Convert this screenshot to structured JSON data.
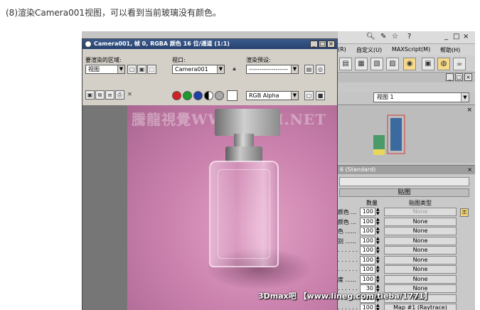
{
  "caption": "(8)渲染Camera001视图，可以看到当前玻璃没有颜色。",
  "render_window": {
    "title": "Camera001, 帧 0, RGBA 颜色 16 位/通道 (1:1)",
    "area_label": "要渲染的区域:",
    "area_value": "视图",
    "viewport_label": "视口:",
    "viewport_value": "Camera001",
    "preset_label": "渲染预设:",
    "preset_value": "-------------------",
    "channel_value": "RGB Alpha",
    "watermark": "騰龍視覺WWW.TLVI.NET"
  },
  "max_window": {
    "title_icons": [
      "binoculars-icon",
      "search-icon",
      "star-icon",
      "help-icon"
    ],
    "menu": [
      "(R)",
      "自定义(U)",
      "MAXScript(M)",
      "帮助(H)"
    ],
    "viewport_select": "视图 1",
    "mat_header": "6 (Standard)",
    "maps_title": "贴图",
    "col_amount": "数量",
    "col_maptype": "贴图类型",
    "rows": [
      {
        "label": "颜色 ...",
        "amount": "100",
        "map": "None",
        "disabled": true
      },
      {
        "label": "颜色 ...",
        "amount": "100",
        "map": "None",
        "disabled": false
      },
      {
        "label": "色 ......",
        "amount": "100",
        "map": "None",
        "disabled": false
      },
      {
        "label": "别 ......",
        "amount": "100",
        "map": "None",
        "disabled": false
      },
      {
        "label": ". . . . . .",
        "amount": "100",
        "map": "None",
        "disabled": false
      },
      {
        "label": ". . . . . .",
        "amount": "100",
        "map": "None",
        "disabled": false
      },
      {
        "label": ". . . . . .",
        "amount": "100",
        "map": "None",
        "disabled": false
      },
      {
        "label": "度 ......",
        "amount": "100",
        "map": "None",
        "disabled": false
      },
      {
        "label": ". . . . . .",
        "amount": "30",
        "map": "None",
        "disabled": false
      },
      {
        "label": ". . . . . .",
        "amount": "100",
        "map": "None",
        "disabled": false
      },
      {
        "label": ". . . . . .",
        "amount": "100",
        "map": "Map #1 (Raytrace)",
        "disabled": false
      }
    ]
  },
  "bottom_watermark": "3Dmax吧 【www.lineg.com/tieba/1771】",
  "colors": {
    "render_bg": "#c77eaa",
    "title_bar": "#3a5a8e",
    "active_icon": "#f6d98a"
  }
}
